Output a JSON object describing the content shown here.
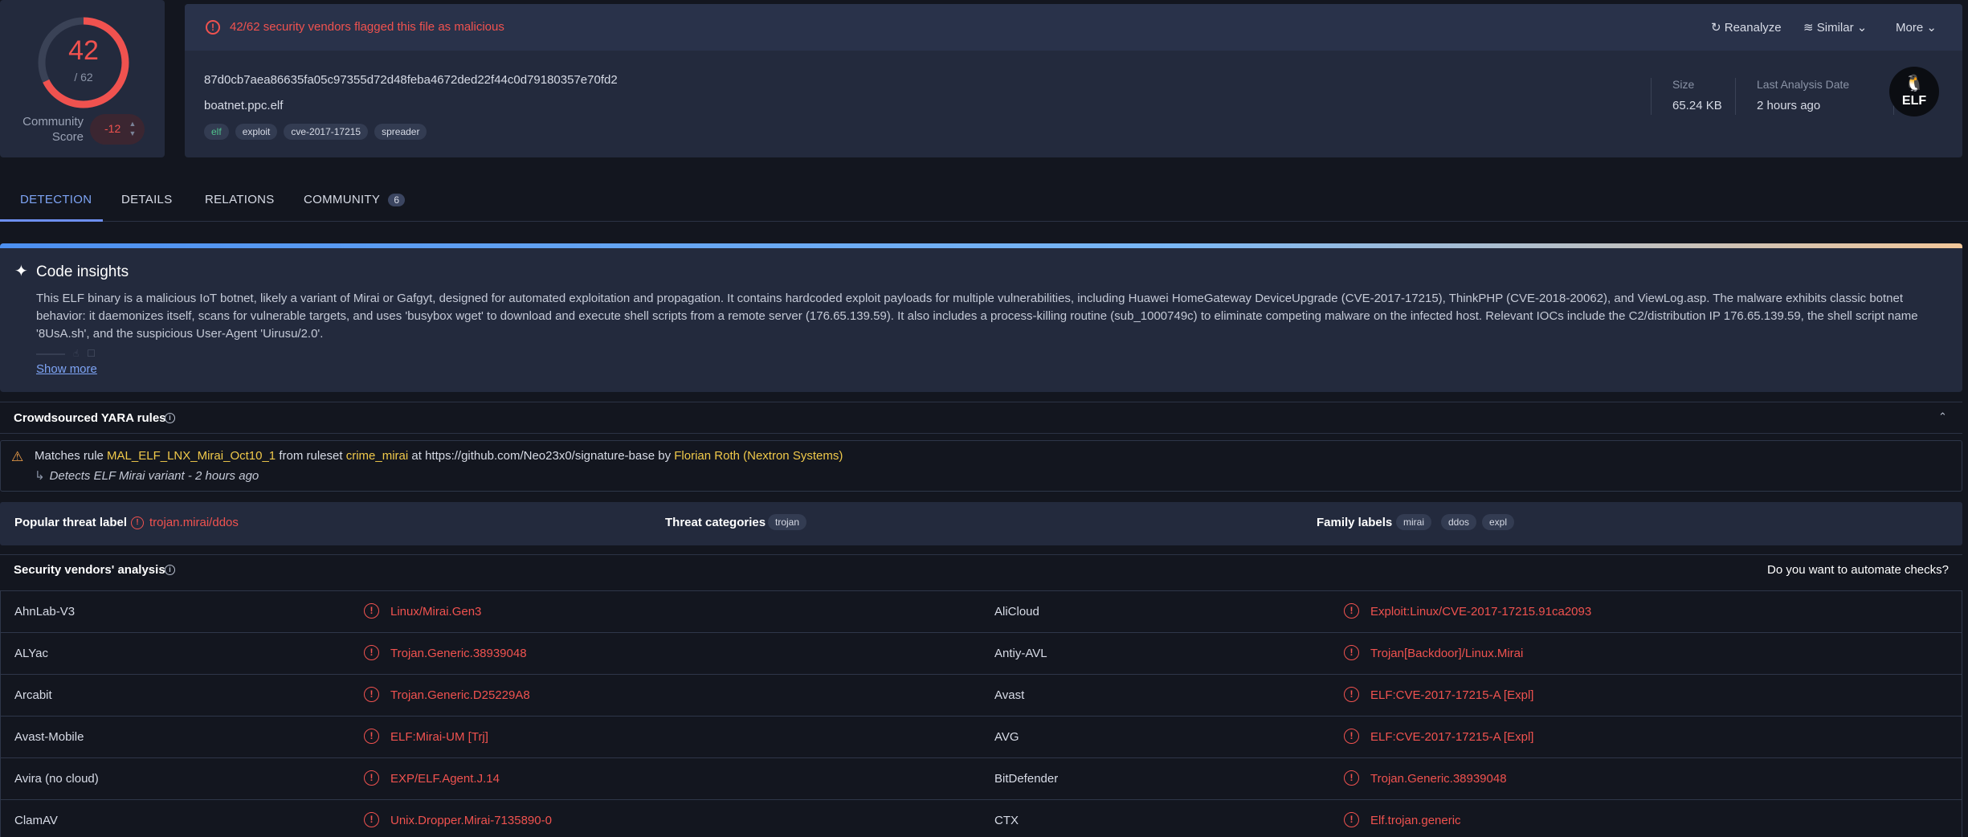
{
  "score": {
    "detections": "42",
    "total": "/ 62",
    "ratio": 0.677,
    "community_label_line1": "Community",
    "community_label_line2": "Score",
    "community_value": "-12",
    "ring_color": "#f0524f"
  },
  "alert": {
    "icon": "alert-circle-icon",
    "text": "42/62 security vendors flagged this file as malicious"
  },
  "actions": {
    "reanalyze": "Reanalyze",
    "similar": "Similar",
    "more": "More"
  },
  "file": {
    "hash": "87d0cb7aea86635fa05c97355d72d48feba4672ded22f44c0d79180357e70fd2",
    "name": "boatnet.ppc.elf",
    "tags": [
      "elf",
      "exploit",
      "cve-2017-17215",
      "spreader"
    ],
    "size_label": "Size",
    "size_value": "65.24 KB",
    "date_label": "Last Analysis Date",
    "date_value": "2 hours ago",
    "type_badge": "ELF"
  },
  "tabs": {
    "detection": "DETECTION",
    "details": "DETAILS",
    "relations": "RELATIONS",
    "community": "COMMUNITY",
    "community_count": "6"
  },
  "insights": {
    "title": "Code insights",
    "body": "This ELF binary is a malicious IoT botnet, likely a variant of Mirai or Gafgyt, designed for automated exploitation and propagation. It contains hardcoded exploit payloads for multiple vulnerabilities, including Huawei HomeGateway DeviceUpgrade (CVE-2017-17215), ThinkPHP (CVE-2018-20062), and ViewLog.asp. The malware exhibits classic botnet behavior: it daemonizes itself, scans for vulnerable targets, and uses 'busybox wget' to download and execute shell scripts from a remote server (176.65.139.59). It also includes a process-killing routine (sub_1000749c) to eliminate competing malware on the infected host. Relevant IOCs include the C2/distribution IP 176.65.139.59, the shell script name '8UsA.sh', and the suspicious User-Agent 'Uirusu/2.0'.",
    "show_more": "Show more"
  },
  "yara": {
    "title": "Crowdsourced YARA rules",
    "matches": "Matches rule",
    "rule": "MAL_ELF_LNX_Mirai_Oct10_1",
    "from_ruleset": "from ruleset",
    "ruleset": "crime_mirai",
    "at": "at https://github.com/Neo23x0/signature-base by",
    "author": "Florian Roth (Nextron Systems)",
    "description": "Detects ELF Mirai variant - 2 hours ago"
  },
  "threat": {
    "popular_label": "Popular threat label",
    "popular_value": "trojan.mirai/ddos",
    "categories_label": "Threat categories",
    "categories": [
      "trojan"
    ],
    "family_label": "Family labels",
    "families": [
      "mirai",
      "ddos",
      "expl"
    ]
  },
  "vendors": {
    "title": "Security vendors' analysis",
    "automate": "Do you want to automate checks?",
    "rows": [
      {
        "left_name": "AhnLab-V3",
        "left_result": "Linux/Mirai.Gen3",
        "right_name": "AliCloud",
        "right_result": "Exploit:Linux/CVE-2017-17215.91ca2093"
      },
      {
        "left_name": "ALYac",
        "left_result": "Trojan.Generic.38939048",
        "right_name": "Antiy-AVL",
        "right_result": "Trojan[Backdoor]/Linux.Mirai"
      },
      {
        "left_name": "Arcabit",
        "left_result": "Trojan.Generic.D25229A8",
        "right_name": "Avast",
        "right_result": "ELF:CVE-2017-17215-A [Expl]"
      },
      {
        "left_name": "Avast-Mobile",
        "left_result": "ELF:Mirai-UM [Trj]",
        "right_name": "AVG",
        "right_result": "ELF:CVE-2017-17215-A [Expl]"
      },
      {
        "left_name": "Avira (no cloud)",
        "left_result": "EXP/ELF.Agent.J.14",
        "right_name": "BitDefender",
        "right_result": "Trojan.Generic.38939048"
      },
      {
        "left_name": "ClamAV",
        "left_result": "Unix.Dropper.Mirai-7135890-0",
        "right_name": "CTX",
        "right_result": "Elf.trojan.generic"
      }
    ]
  }
}
